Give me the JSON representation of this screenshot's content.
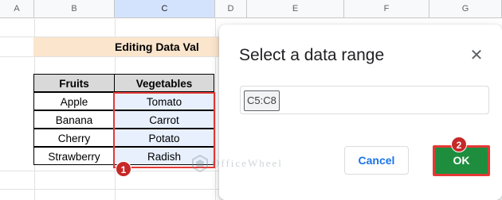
{
  "columns": [
    "A",
    "B",
    "C",
    "D",
    "E",
    "F",
    "G"
  ],
  "sheet_title": "Editing Data Val",
  "table": {
    "headers": [
      "Fruits",
      "Vegetables"
    ],
    "rows": [
      [
        "Apple",
        "Tomato"
      ],
      [
        "Banana",
        "Carrot"
      ],
      [
        "Cherry",
        "Potato"
      ],
      [
        "Strawberry",
        "Radish"
      ]
    ]
  },
  "dialog": {
    "title": "Select a data range",
    "close_icon": "✕",
    "range_value": "C5:C8",
    "cancel_label": "Cancel",
    "ok_label": "OK"
  },
  "annotations": {
    "step1": "1",
    "step2": "2"
  },
  "watermark": "OfficeWheel",
  "colors": {
    "title_band": "#fce5cd",
    "header_fill": "#d9d9d9",
    "selection_fill": "#e8f0fe",
    "highlight_red": "#e53935",
    "ok_green": "#1e8e3e",
    "cancel_blue": "#1a73e8"
  }
}
